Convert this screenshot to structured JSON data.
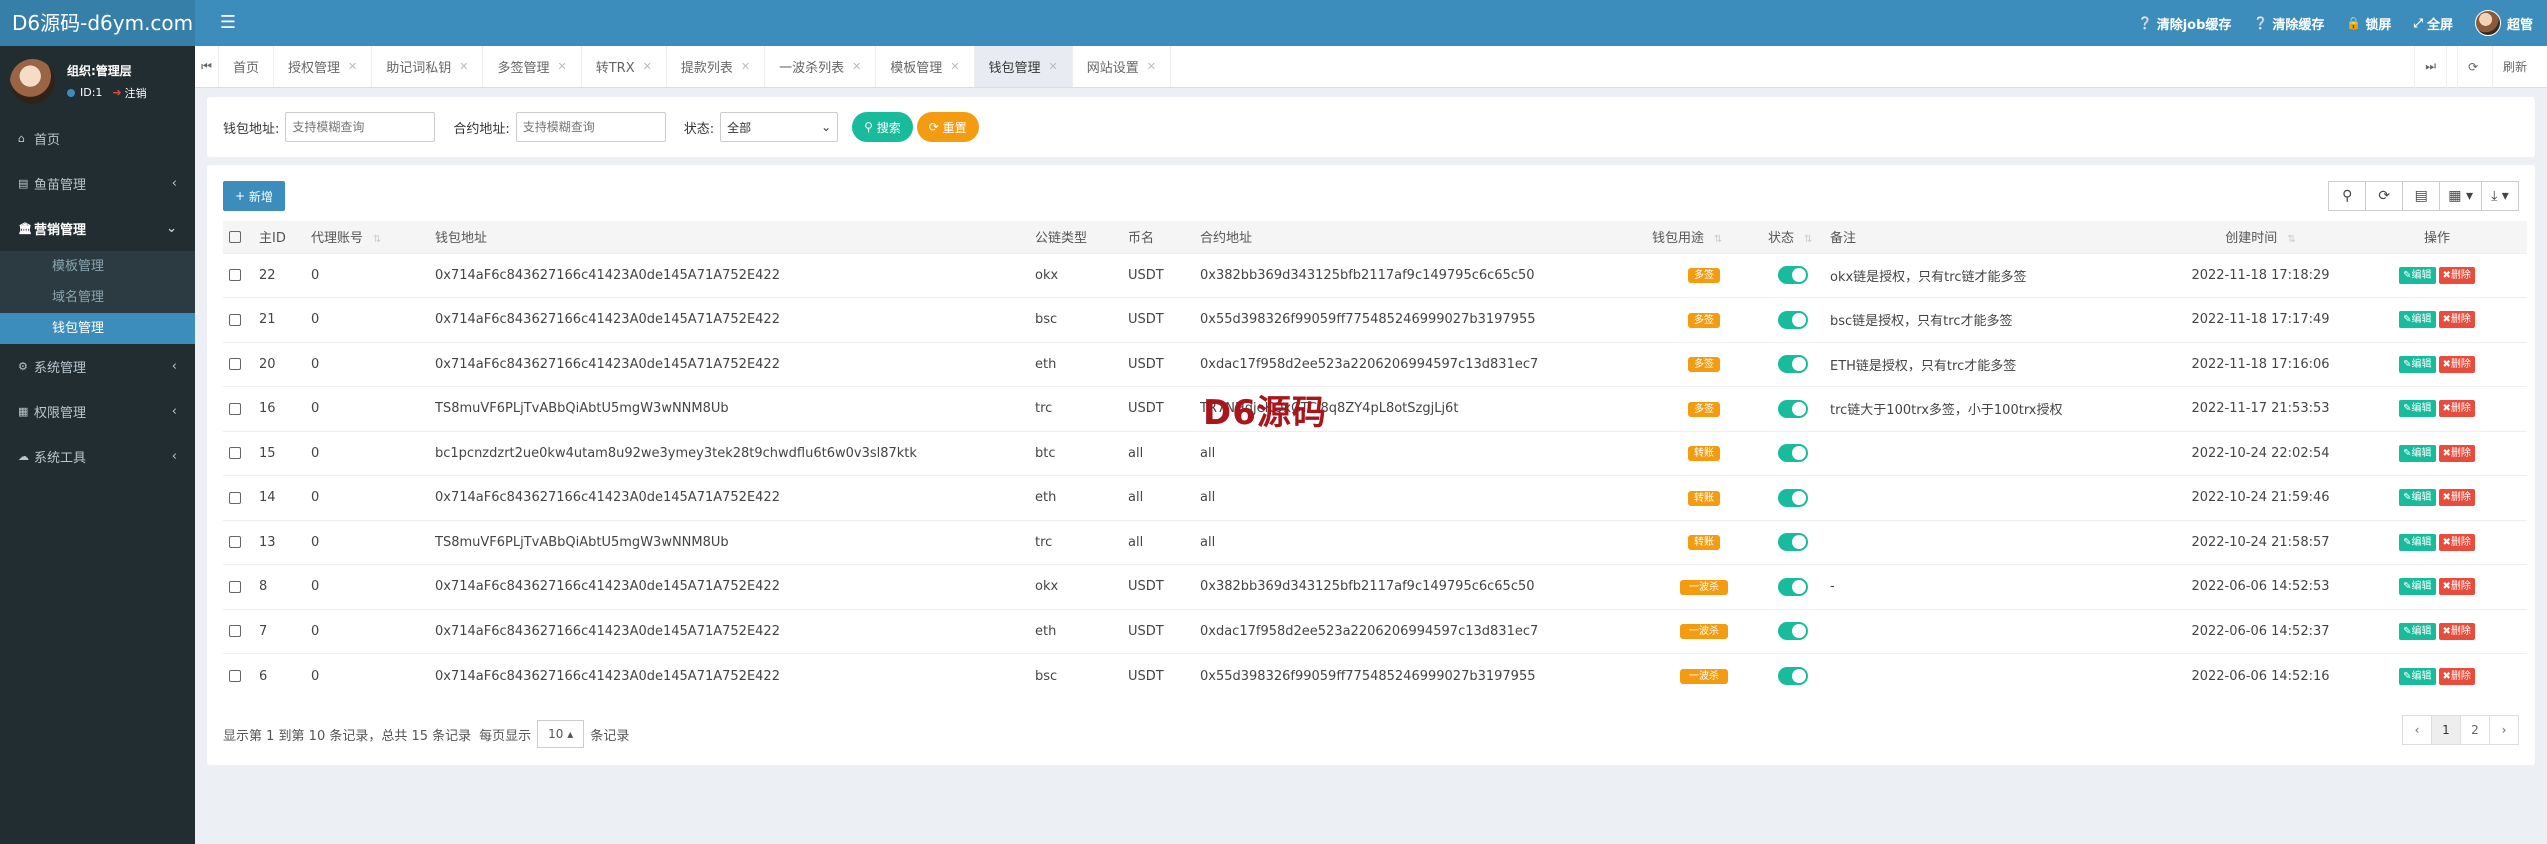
{
  "app": {
    "logo": "D6源码-d6ym.com",
    "menu_icon": "bars-icon"
  },
  "header": {
    "items": [
      {
        "icon": "question-circle-icon",
        "label": "清除job缓存"
      },
      {
        "icon": "question-circle-icon",
        "label": "清除缓存"
      },
      {
        "icon": "lock-icon",
        "label": "锁屏"
      },
      {
        "icon": "expand-icon",
        "label": "全屏"
      }
    ],
    "user": "超管"
  },
  "sidebar": {
    "user_name": "组织:管理层",
    "user_id": "ID:1",
    "logout": "注销",
    "items": [
      {
        "icon": "home-icon",
        "label": "首页"
      },
      {
        "icon": "list-icon",
        "label": "鱼苗管理"
      },
      {
        "icon": "bank-icon",
        "label": "营销管理"
      },
      {
        "icon": "gear-icon",
        "label": "系统管理"
      },
      {
        "icon": "table-icon",
        "label": "权限管理"
      },
      {
        "icon": "cloud-icon",
        "label": "系统工具"
      }
    ],
    "sub_items": [
      "模板管理",
      "域名管理",
      "钱包管理"
    ]
  },
  "tabs": {
    "items": [
      "首页",
      "授权管理",
      "助记词私钥",
      "多签管理",
      "转TRX",
      "提款列表",
      "一波杀列表",
      "模板管理",
      "钱包管理",
      "网站设置"
    ],
    "active": "钱包管理",
    "refresh": "刷新"
  },
  "search": {
    "wallet_label": "钱包地址:",
    "wallet_placeholder": "支持模糊查询",
    "contract_label": "合约地址:",
    "contract_placeholder": "支持模糊查询",
    "status_label": "状态:",
    "status_value": "全部",
    "search_btn": "搜索",
    "reset_btn": "重置"
  },
  "toolbar": {
    "add_label": "新增"
  },
  "table": {
    "headers": [
      "主ID",
      "代理账号",
      "钱包地址",
      "公链类型",
      "币名",
      "合约地址",
      "钱包用途",
      "状态",
      "备注",
      "创建时间",
      "操作"
    ],
    "edit_label": "编辑",
    "delete_label": "删除",
    "rows": [
      {
        "id": "22",
        "agent": "0",
        "wallet": "0x714aF6c843627166c41423A0de145A71A752E422",
        "chain": "okx",
        "coin": "USDT",
        "contract": "0x382bb369d343125bfb2117af9c149795c6c65c50",
        "use": "多签",
        "remark": "okx链是授权，只有trc链才能多签",
        "time": "2022-11-18 17:18:29"
      },
      {
        "id": "21",
        "agent": "0",
        "wallet": "0x714aF6c843627166c41423A0de145A71A752E422",
        "chain": "bsc",
        "coin": "USDT",
        "contract": "0x55d398326f99059ff775485246999027b3197955",
        "use": "多签",
        "remark": "bsc链是授权，只有trc才能多签",
        "time": "2022-11-18 17:17:49"
      },
      {
        "id": "20",
        "agent": "0",
        "wallet": "0x714aF6c843627166c41423A0de145A71A752E422",
        "chain": "eth",
        "coin": "USDT",
        "contract": "0xdac17f958d2ee523a2206206994597c13d831ec7",
        "use": "多签",
        "remark": "ETH链是授权，只有trc才能多签",
        "time": "2022-11-18 17:16:06"
      },
      {
        "id": "16",
        "agent": "0",
        "wallet": "TS8muVF6PLjTvABbQiAbtU5mgW3wNNM8Ub",
        "chain": "trc",
        "coin": "USDT",
        "contract": "TR7NHqjeKQxGTCi8q8ZY4pL8otSzgjLj6t",
        "use": "多签",
        "remark": "trc链大于100trx多签，小于100trx授权",
        "time": "2022-11-17 21:53:53"
      },
      {
        "id": "15",
        "agent": "0",
        "wallet": "bc1pcnzdzrt2ue0kw4utam8u92we3ymey3tek28t9chwdflu6t6w0v3sl87ktk",
        "chain": "btc",
        "coin": "all",
        "contract": "all",
        "use": "转账",
        "remark": "",
        "time": "2022-10-24 22:02:54"
      },
      {
        "id": "14",
        "agent": "0",
        "wallet": "0x714aF6c843627166c41423A0de145A71A752E422",
        "chain": "eth",
        "coin": "all",
        "contract": "all",
        "use": "转账",
        "remark": "",
        "time": "2022-10-24 21:59:46"
      },
      {
        "id": "13",
        "agent": "0",
        "wallet": "TS8muVF6PLjTvABbQiAbtU5mgW3wNNM8Ub",
        "chain": "trc",
        "coin": "all",
        "contract": "all",
        "use": "转账",
        "remark": "",
        "time": "2022-10-24 21:58:57"
      },
      {
        "id": "8",
        "agent": "0",
        "wallet": "0x714aF6c843627166c41423A0de145A71A752E422",
        "chain": "okx",
        "coin": "USDT",
        "contract": "0x382bb369d343125bfb2117af9c149795c6c65c50",
        "use": "一波杀",
        "remark": "-",
        "time": "2022-06-06 14:52:53"
      },
      {
        "id": "7",
        "agent": "0",
        "wallet": "0x714aF6c843627166c41423A0de145A71A752E422",
        "chain": "eth",
        "coin": "USDT",
        "contract": "0xdac17f958d2ee523a2206206994597c13d831ec7",
        "use": "一波杀",
        "remark": "",
        "time": "2022-06-06 14:52:37"
      },
      {
        "id": "6",
        "agent": "0",
        "wallet": "0x714aF6c843627166c41423A0de145A71A752E422",
        "chain": "bsc",
        "coin": "USDT",
        "contract": "0x55d398326f99059ff775485246999027b3197955",
        "use": "一波杀",
        "remark": "",
        "time": "2022-06-06 14:52:16"
      }
    ]
  },
  "pagination": {
    "info_prefix": "显示第 1 到第 10 条记录，总共 15 条记录",
    "per_page_label": "每页显示",
    "page_size": "10",
    "suffix": "条记录",
    "pages": [
      "‹",
      "1",
      "2",
      "›"
    ],
    "current": "1"
  },
  "watermark": "D6源码",
  "colors": {
    "header": "#3c8dbc",
    "sidebar": "#222d32",
    "success": "#18bc9c",
    "warning": "#f39c12",
    "danger": "#e74c3c"
  }
}
